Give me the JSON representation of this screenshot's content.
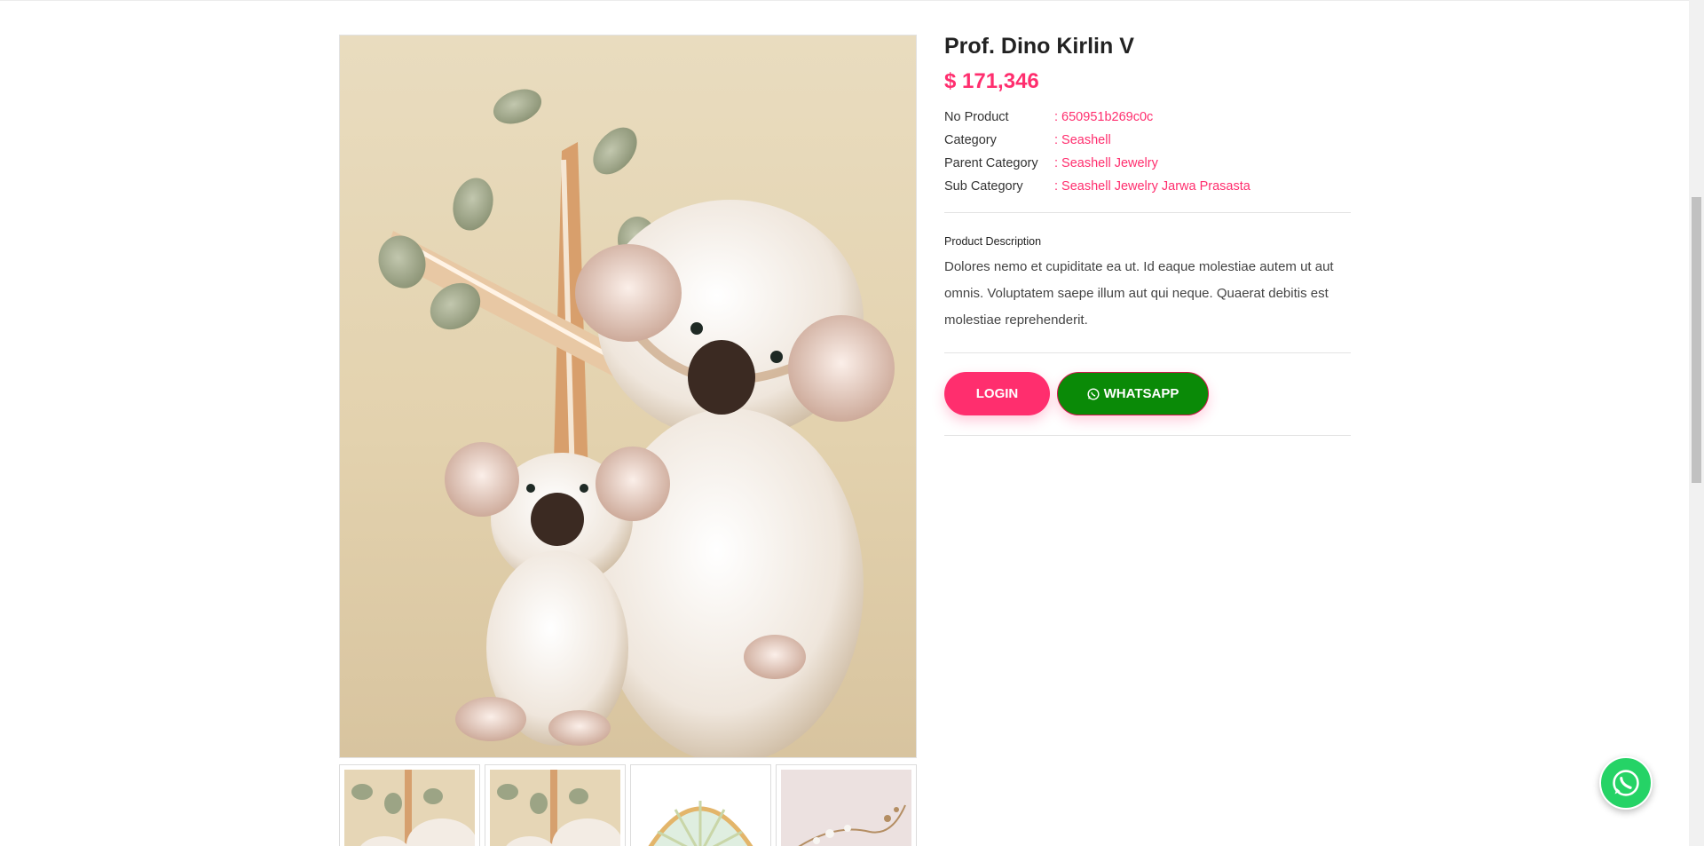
{
  "product": {
    "title": "Prof. Dino Kirlin V",
    "price": "$ 171,346",
    "info": [
      {
        "label": "No Product",
        "value": ": 650951b269c0c"
      },
      {
        "label": "Category",
        "value": ": Seashell"
      },
      {
        "label": "Parent Category",
        "value": ": Seashell Jewelry"
      },
      {
        "label": "Sub Category",
        "value": ": Seashell Jewelry Jarwa Prasasta"
      }
    ],
    "description_label": "Product Description",
    "description": "Dolores nemo et cupiditate ea ut. Id eaque molestiae autem ut aut omnis. Voluptatem saepe illum aut qui neque. Quaerat debitis est molestiae reprehenderit."
  },
  "buttons": {
    "login": "LOGIN",
    "whatsapp": "WHATSAPP"
  },
  "icons": {
    "whatsapp": "whatsapp-icon",
    "floating": "whatsapp-icon"
  },
  "colors": {
    "accent": "#ff2e6e",
    "whatsapp_button": "#0a8a07",
    "whatsapp_float": "#25d366"
  }
}
